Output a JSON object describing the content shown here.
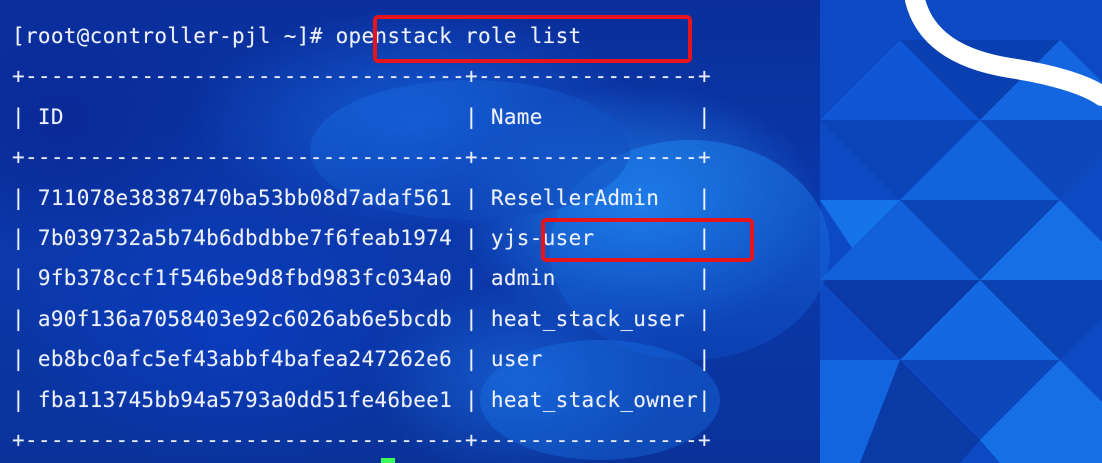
{
  "terminal": {
    "prompt": "[root@controller-pjl ~]# ",
    "command": "openstack role list",
    "border_line": "+----------------------------------+-----------------+",
    "header": {
      "id": "ID",
      "name": "Name"
    },
    "rows": [
      {
        "id": "711078e38387470ba53bb08d7adaf561",
        "name": "ResellerAdmin"
      },
      {
        "id": "7b039732a5b74b6dbdbbe7f6feab1974",
        "name": "yjs-user"
      },
      {
        "id": "9fb378ccf1f546be9d8fbd983fc034a0",
        "name": "admin"
      },
      {
        "id": "a90f136a7058403e92c6026ab6e5bcdb",
        "name": "heat_stack_user"
      },
      {
        "id": "eb8bc0afc5ef43abbf4bafea247262e6",
        "name": "user"
      },
      {
        "id": "fba113745bb94a5793a0dd51fe46bee1",
        "name": "heat_stack_owner"
      }
    ]
  },
  "colors": {
    "highlight": "#e8141b",
    "text": "#eef1ff",
    "background": "#0d3fb4",
    "wallpaper_accent": "#ffffff",
    "cursor": "#3dff5b"
  }
}
